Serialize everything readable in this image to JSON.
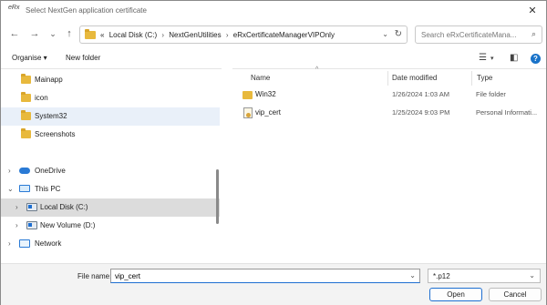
{
  "window": {
    "app_icon_text": "eRx",
    "title": "Select NextGen application certificate",
    "close_glyph": "✕"
  },
  "nav": {
    "back_glyph": "←",
    "forward_glyph": "→",
    "recent_glyph": "⌄",
    "up_glyph": "↑",
    "breadcrumb_prefix": "«",
    "breadcrumbs": [
      "Local Disk (C:)",
      "NextGenUtilities",
      "eRxCertificateManagerVIPOnly"
    ],
    "breadcrumb_sep": "›",
    "search_placeholder": "Search eRxCertificateMana..."
  },
  "toolbar": {
    "organise_label": "Organise ▾",
    "new_folder_label": "New folder"
  },
  "navpane": {
    "items": [
      {
        "label": "Mainapp"
      },
      {
        "label": "icon"
      },
      {
        "label": "System32"
      },
      {
        "label": "Screenshots"
      },
      {
        "label": "OneDrive"
      },
      {
        "label": "This PC"
      },
      {
        "label": "Local Disk (C:)"
      },
      {
        "label": "New Volume (D:)"
      },
      {
        "label": "Network"
      }
    ]
  },
  "filelist": {
    "columns": {
      "name": "Name",
      "date": "Date modified",
      "type": "Type"
    },
    "rows": [
      {
        "name": "Win32",
        "date": "1/26/2024 1:03 AM",
        "type": "File folder"
      },
      {
        "name": "vip_cert",
        "date": "1/25/2024 9:03 PM",
        "type": "Personal Informati..."
      }
    ]
  },
  "bottom": {
    "file_name_label": "File name:",
    "file_name_value": "vip_cert",
    "file_type_value": "*.p12",
    "open_label": "Open",
    "cancel_label": "Cancel"
  }
}
